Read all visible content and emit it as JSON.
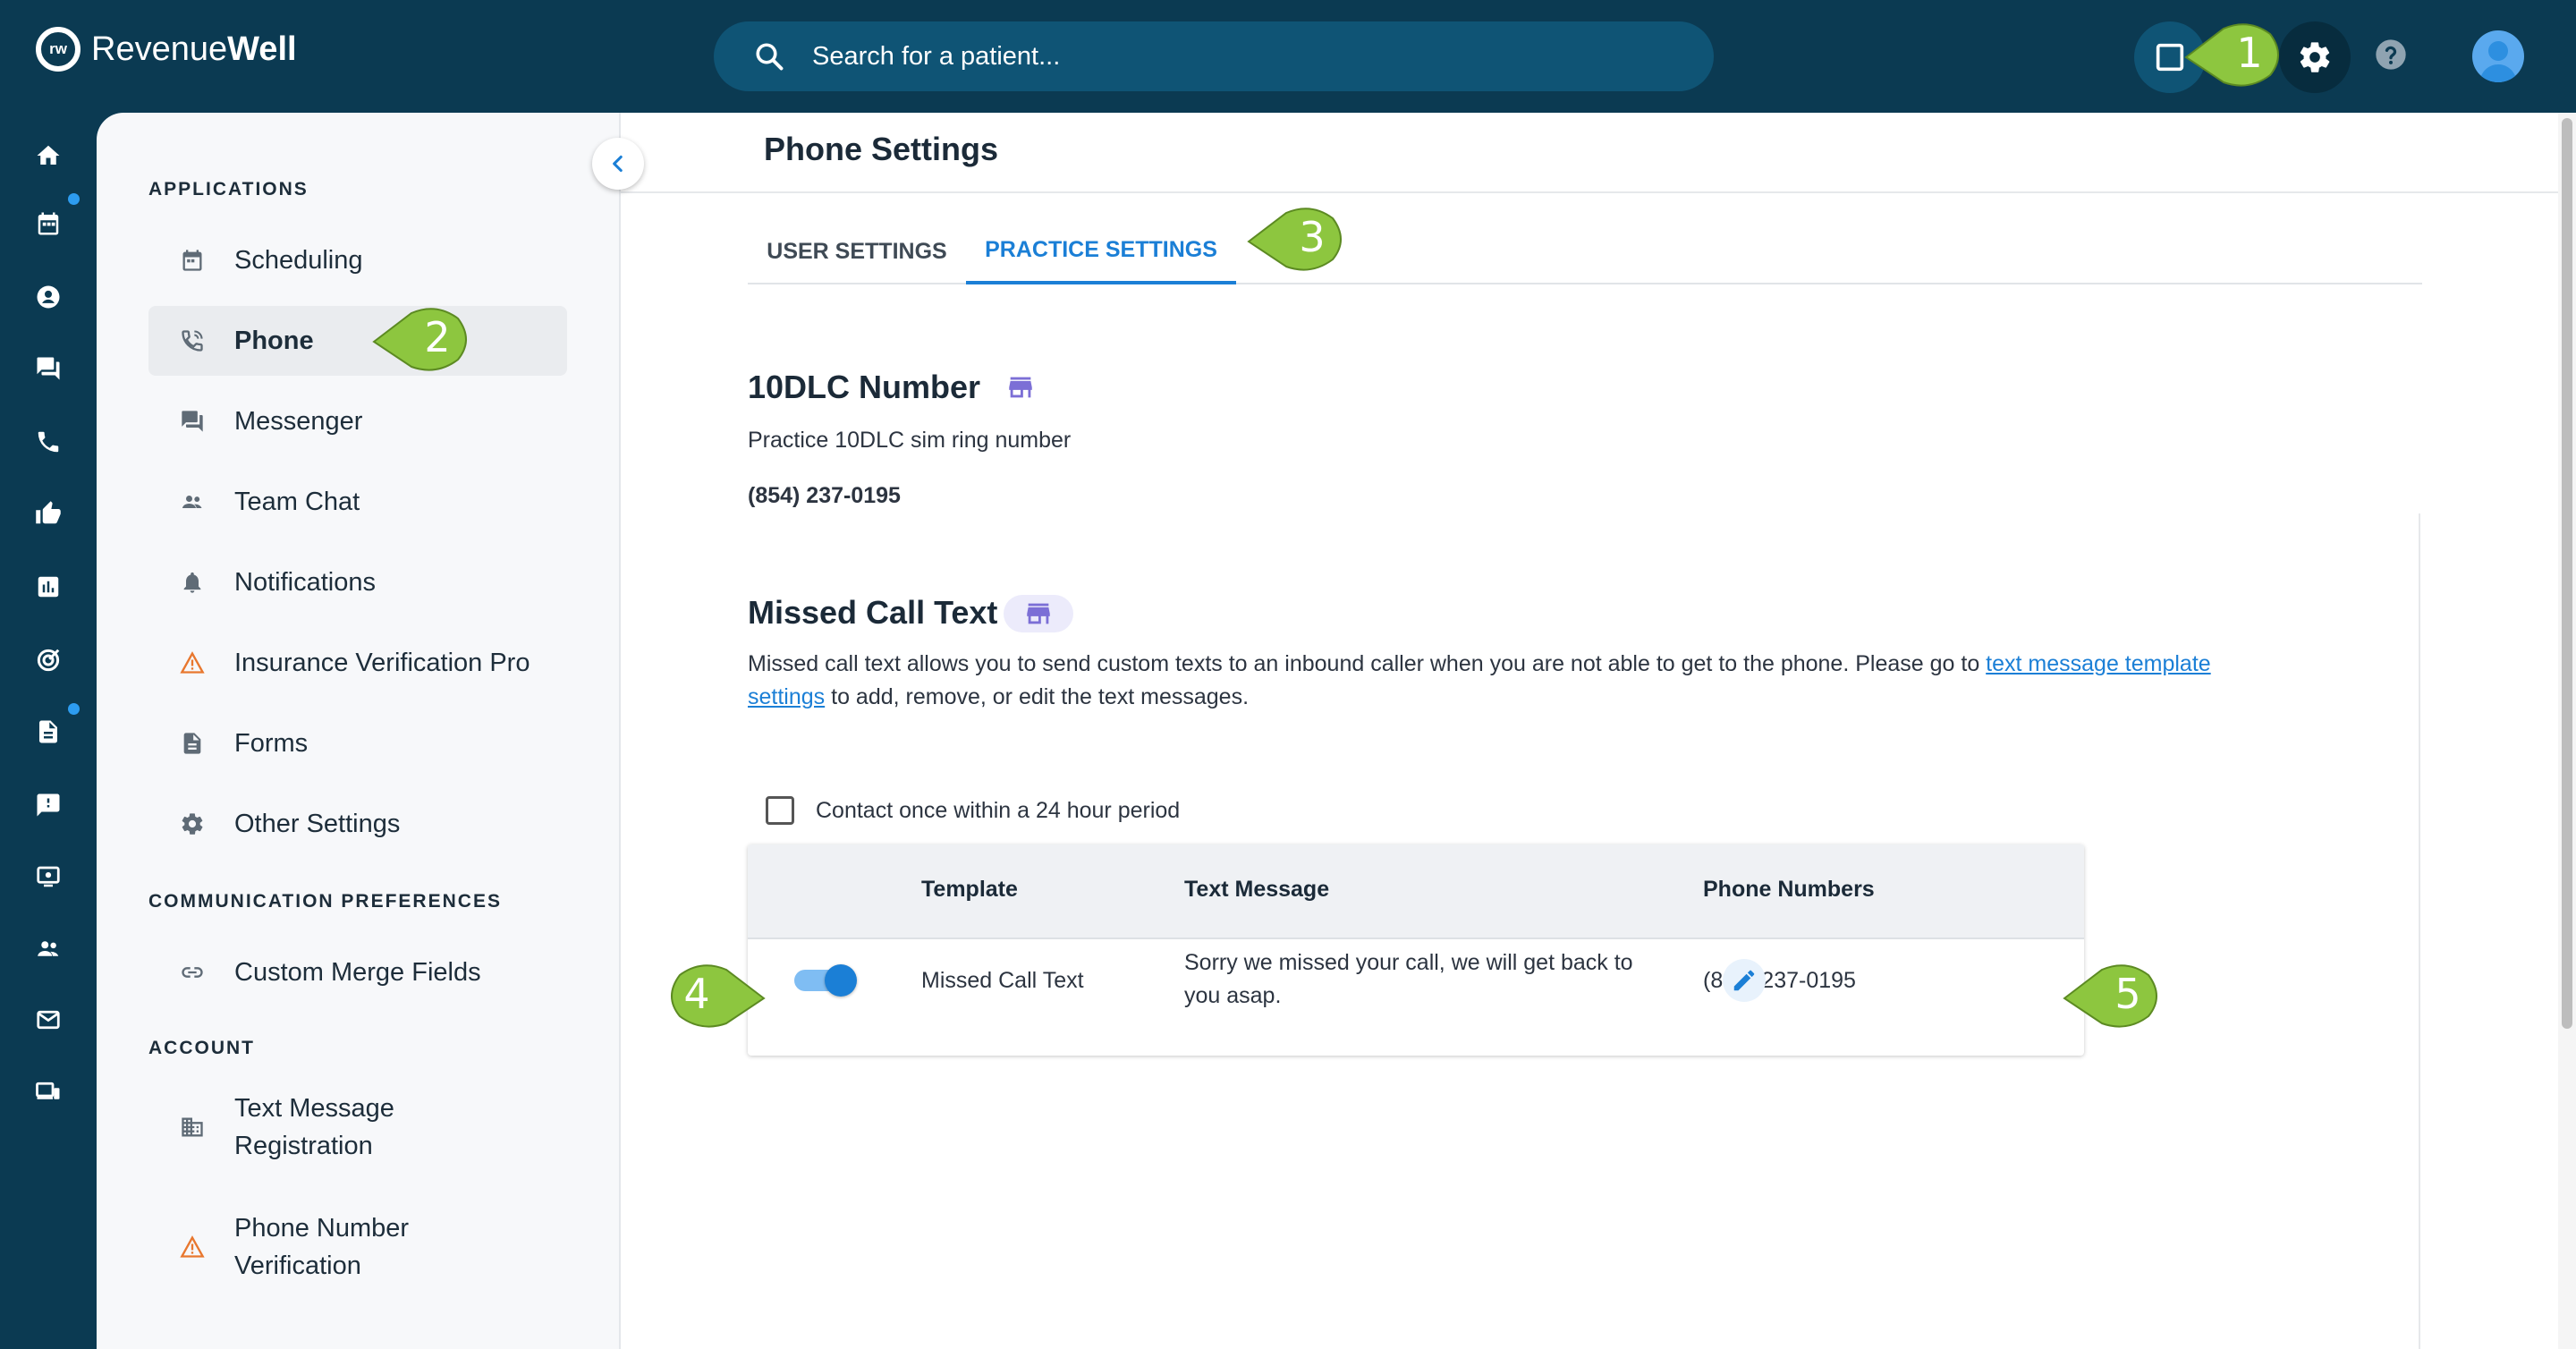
{
  "app": {
    "brand_light": "Revenue",
    "brand_bold": "Well",
    "logo_mark": "rw"
  },
  "search": {
    "placeholder": "Search for a patient..."
  },
  "sidebar": {
    "applications_title": "APPLICATIONS",
    "applications": [
      {
        "label": "Scheduling",
        "icon": "calendar-icon"
      },
      {
        "label": "Phone",
        "icon": "phone-icon",
        "active": true
      },
      {
        "label": "Messenger",
        "icon": "chat-icon"
      },
      {
        "label": "Team Chat",
        "icon": "people-icon"
      },
      {
        "label": "Notifications",
        "icon": "bell-icon"
      },
      {
        "label": "Insurance Verification Pro",
        "icon": "warning-icon"
      },
      {
        "label": "Forms",
        "icon": "document-icon"
      },
      {
        "label": "Other Settings",
        "icon": "gear-icon"
      }
    ],
    "communication_title": "COMMUNICATION PREFERENCES",
    "communication": [
      {
        "label": "Custom Merge Fields",
        "icon": "link-icon"
      }
    ],
    "account_title": "ACCOUNT",
    "account": [
      {
        "label_line1": "Text Message",
        "label_line2": "Registration",
        "icon": "building-icon"
      },
      {
        "label_line1": "Phone Number",
        "label_line2": "Verification",
        "icon": "warning-icon"
      }
    ]
  },
  "main": {
    "page_title": "Phone Settings",
    "tabs": [
      {
        "label": "USER SETTINGS"
      },
      {
        "label": "PRACTICE SETTINGS",
        "active": true
      }
    ],
    "dlc": {
      "title": "10DLC Number",
      "description": "Practice 10DLC sim ring number",
      "number": "(854) 237-0195"
    },
    "missed_call": {
      "title": "Missed Call Text",
      "desc_before": "Missed call text allows you to send custom texts to an inbound caller when you are not able to get to the phone. Please go to ",
      "link_part1": "text message template",
      "link_part2": "settings",
      "desc_after": " to add, remove, or edit the text messages.",
      "checkbox_label": "Contact once within a 24 hour period",
      "checkbox_checked": false
    },
    "table": {
      "headers": {
        "template": "Template",
        "text_message": "Text Message",
        "phone_numbers": "Phone Numbers"
      },
      "rows": [
        {
          "enabled": true,
          "template": "Missed Call Text",
          "text_line1": "Sorry we missed your call, we will get back to",
          "text_line2": "you asap.",
          "phone": "(854) 237-0195"
        }
      ]
    }
  },
  "callouts": [
    "1",
    "2",
    "3",
    "4",
    "5"
  ],
  "colors": {
    "navy": "#0b3a52",
    "accent_blue": "#1b7fd6",
    "callout_green": "#8dc63f",
    "warning_orange": "#e8772e",
    "badge_purple": "#7c6fd6"
  }
}
